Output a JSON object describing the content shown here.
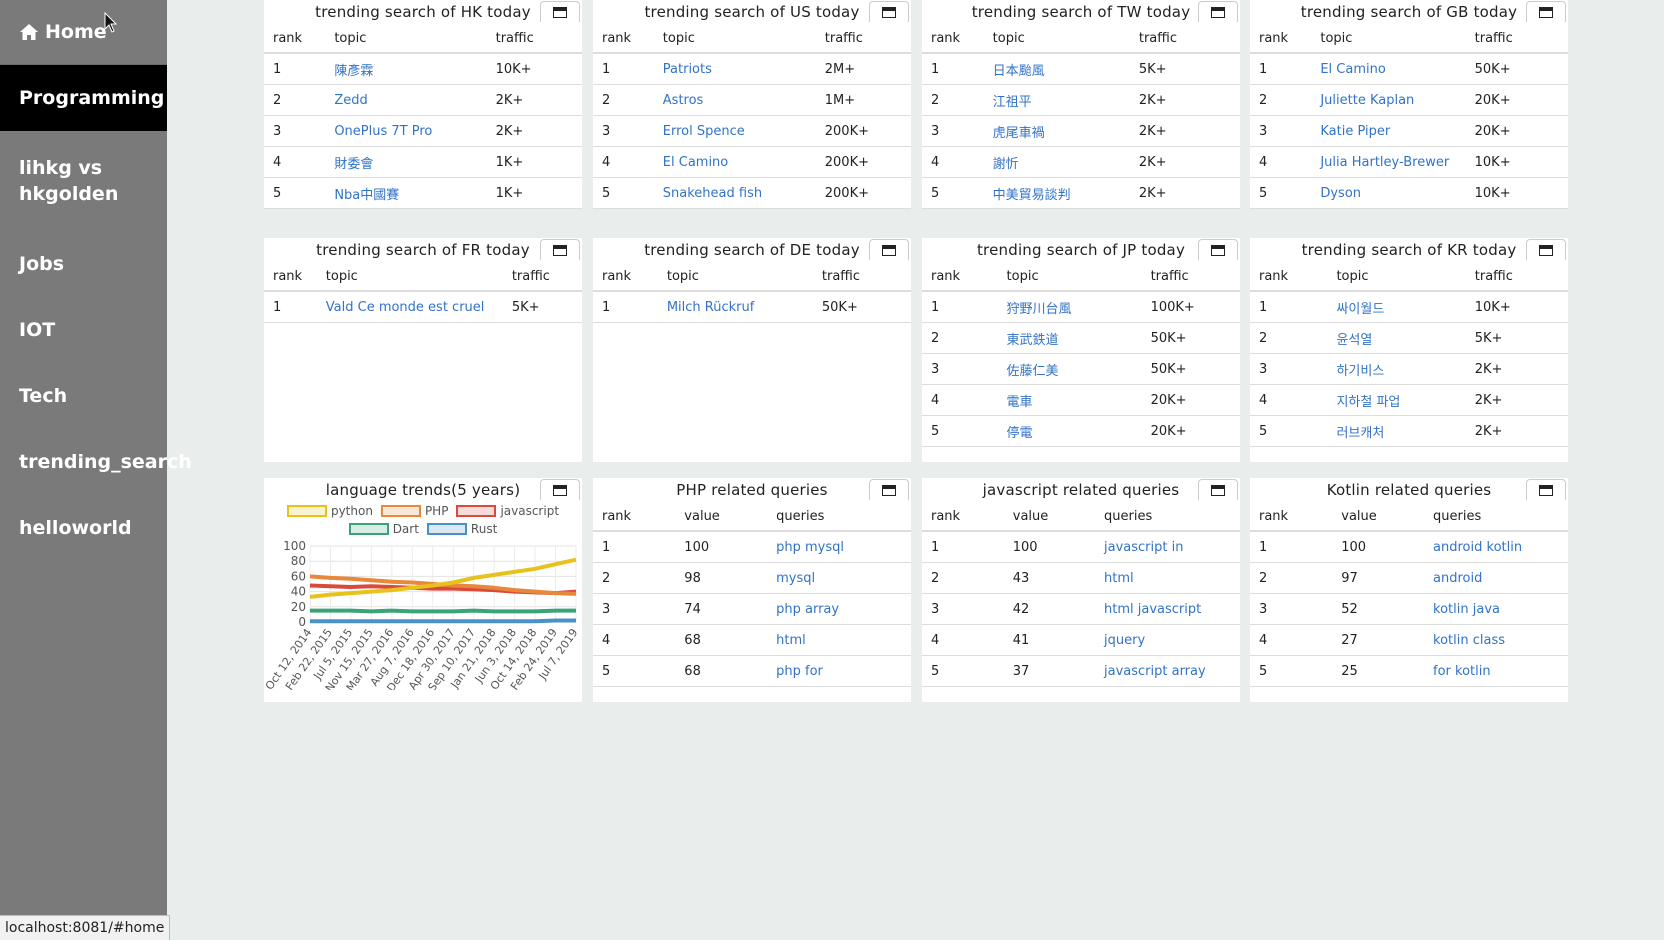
{
  "nav": {
    "home": "Home",
    "items": [
      "Programming",
      "lihkg vs hkgolden",
      "Jobs",
      "IOT",
      "Tech",
      "trending_search",
      "helloworld"
    ],
    "active": "Programming"
  },
  "status_url": "localhost:8081/#home",
  "trend_panels": [
    {
      "title": "trending search of HK today",
      "headers": [
        "rank",
        "topic",
        "traffic"
      ],
      "rows": [
        [
          "1",
          "陳彥霖",
          "10K+"
        ],
        [
          "2",
          "Zedd",
          "2K+"
        ],
        [
          "3",
          "OnePlus 7T Pro",
          "2K+"
        ],
        [
          "4",
          "財委會",
          "1K+"
        ],
        [
          "5",
          "Nba中國賽",
          "1K+"
        ]
      ]
    },
    {
      "title": "trending search of US today",
      "headers": [
        "rank",
        "topic",
        "traffic"
      ],
      "rows": [
        [
          "1",
          "Patriots",
          "2M+"
        ],
        [
          "2",
          "Astros",
          "1M+"
        ],
        [
          "3",
          "Errol Spence",
          "200K+"
        ],
        [
          "4",
          "El Camino",
          "200K+"
        ],
        [
          "5",
          "Snakehead fish",
          "200K+"
        ]
      ]
    },
    {
      "title": "trending search of TW today",
      "headers": [
        "rank",
        "topic",
        "traffic"
      ],
      "rows": [
        [
          "1",
          "日本颱風",
          "5K+"
        ],
        [
          "2",
          "江祖平",
          "2K+"
        ],
        [
          "3",
          "虎尾車禍",
          "2K+"
        ],
        [
          "4",
          "謝忻",
          "2K+"
        ],
        [
          "5",
          "中美貿易談判",
          "2K+"
        ]
      ]
    },
    {
      "title": "trending search of GB today",
      "headers": [
        "rank",
        "topic",
        "traffic"
      ],
      "rows": [
        [
          "1",
          "El Camino",
          "50K+"
        ],
        [
          "2",
          "Juliette Kaplan",
          "20K+"
        ],
        [
          "3",
          "Katie Piper",
          "20K+"
        ],
        [
          "4",
          "Julia Hartley-Brewer",
          "10K+"
        ],
        [
          "5",
          "Dyson",
          "10K+"
        ]
      ]
    },
    {
      "title": "trending search of FR today",
      "headers": [
        "rank",
        "topic",
        "traffic"
      ],
      "rows": [
        [
          "1",
          "Vald Ce monde est cruel",
          "5K+"
        ]
      ]
    },
    {
      "title": "trending search of DE today",
      "headers": [
        "rank",
        "topic",
        "traffic"
      ],
      "rows": [
        [
          "1",
          "Milch Rückruf",
          "50K+"
        ]
      ]
    },
    {
      "title": "trending search of JP today",
      "headers": [
        "rank",
        "topic",
        "traffic"
      ],
      "rows": [
        [
          "1",
          "狩野川台風",
          "100K+"
        ],
        [
          "2",
          "東武鉄道",
          "50K+"
        ],
        [
          "3",
          "佐藤仁美",
          "50K+"
        ],
        [
          "4",
          "電車",
          "20K+"
        ],
        [
          "5",
          "停電",
          "20K+"
        ]
      ]
    },
    {
      "title": "trending search of KR today",
      "headers": [
        "rank",
        "topic",
        "traffic"
      ],
      "rows": [
        [
          "1",
          "싸이월드",
          "10K+"
        ],
        [
          "2",
          "윤석열",
          "5K+"
        ],
        [
          "3",
          "하기비스",
          "2K+"
        ],
        [
          "4",
          "지하철 파업",
          "2K+"
        ],
        [
          "5",
          "러브캐처",
          "2K+"
        ]
      ]
    }
  ],
  "query_panels": [
    {
      "title": "PHP related queries",
      "headers": [
        "rank",
        "value",
        "queries"
      ],
      "rows": [
        [
          "1",
          "100",
          "php mysql"
        ],
        [
          "2",
          "98",
          "mysql"
        ],
        [
          "3",
          "74",
          "php array"
        ],
        [
          "4",
          "68",
          "html"
        ],
        [
          "5",
          "68",
          "php for"
        ]
      ]
    },
    {
      "title": "javascript related queries",
      "headers": [
        "rank",
        "value",
        "queries"
      ],
      "rows": [
        [
          "1",
          "100",
          "javascript in"
        ],
        [
          "2",
          "43",
          "html"
        ],
        [
          "3",
          "42",
          "html javascript"
        ],
        [
          "4",
          "41",
          "jquery"
        ],
        [
          "5",
          "37",
          "javascript array"
        ]
      ]
    },
    {
      "title": "Kotlin related queries",
      "headers": [
        "rank",
        "value",
        "queries"
      ],
      "rows": [
        [
          "1",
          "100",
          "android kotlin"
        ],
        [
          "2",
          "97",
          "android"
        ],
        [
          "3",
          "52",
          "kotlin java"
        ],
        [
          "4",
          "27",
          "kotlin class"
        ],
        [
          "5",
          "25",
          "for kotlin"
        ]
      ]
    }
  ],
  "chart_data": {
    "type": "line",
    "title": "language trends(5 years)",
    "ylim": [
      0,
      100
    ],
    "yticks": [
      0,
      20,
      40,
      60,
      80,
      100
    ],
    "x": [
      "Oct 12, 2014",
      "Feb 22, 2015",
      "Jul 5, 2015",
      "Nov 15, 2015",
      "Mar 27, 2016",
      "Aug 7, 2016",
      "Dec 18, 2016",
      "Apr 30, 2017",
      "Sep 10, 2017",
      "Jan 21, 2018",
      "Jun 3, 2018",
      "Oct 14, 2018",
      "Feb 24, 2019",
      "Jul 7, 2019"
    ],
    "series": [
      {
        "name": "python",
        "color": "#e8c21a",
        "values": [
          33,
          36,
          38,
          40,
          42,
          45,
          48,
          52,
          58,
          62,
          66,
          70,
          76,
          82
        ]
      },
      {
        "name": "PHP",
        "color": "#e8883a",
        "values": [
          60,
          58,
          57,
          55,
          53,
          52,
          50,
          48,
          47,
          45,
          42,
          40,
          38,
          37
        ]
      },
      {
        "name": "javascript",
        "color": "#d94a3c",
        "values": [
          48,
          47,
          46,
          47,
          46,
          45,
          44,
          44,
          43,
          42,
          40,
          39,
          38,
          40
        ]
      },
      {
        "name": "Dart",
        "color": "#3aa37a",
        "values": [
          15,
          15,
          15,
          14,
          15,
          14,
          14,
          14,
          15,
          14,
          14,
          14,
          15,
          15
        ]
      },
      {
        "name": "Rust",
        "color": "#4a90c9",
        "values": [
          1,
          1,
          1,
          1,
          1,
          1,
          1,
          1,
          1,
          1,
          1,
          1,
          2,
          2
        ]
      }
    ],
    "grid": true,
    "legend": "top"
  }
}
